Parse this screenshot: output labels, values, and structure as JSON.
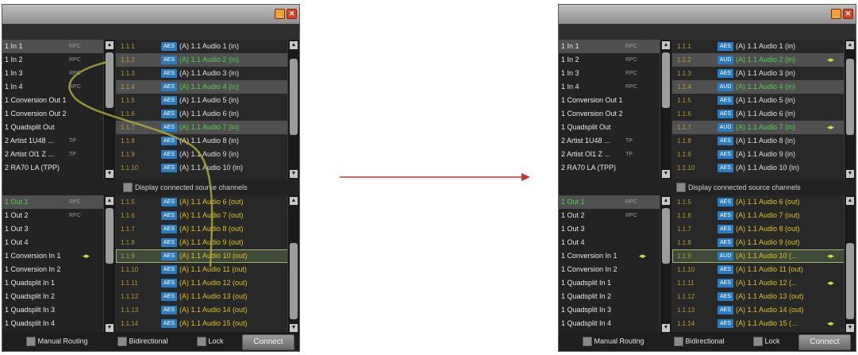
{
  "windows": [
    {
      "sources": [
        {
          "name": "1 In 1",
          "tag": "RPC",
          "conn": "",
          "hl": true
        },
        {
          "name": "1 In 2",
          "tag": "RPC",
          "conn": ""
        },
        {
          "name": "1 In 3",
          "tag": "RPC",
          "conn": ""
        },
        {
          "name": "1 In 4",
          "tag": "RPC",
          "conn": ""
        },
        {
          "name": "1 Conversion Out 1",
          "tag": "",
          "conn": ""
        },
        {
          "name": "1 Conversion Out 2",
          "tag": "",
          "conn": ""
        },
        {
          "name": "1 Quadsplit Out",
          "tag": "",
          "conn": ""
        },
        {
          "name": "2 Artist 1U48 ...",
          "tag": "TP",
          "conn": ""
        },
        {
          "name": "2 Artist Ol1 Z ...",
          "tag": "TP",
          "conn": ""
        },
        {
          "name": "2 RA70 LA (TPP)",
          "tag": "",
          "conn": ""
        }
      ],
      "source_channels": [
        {
          "num": "1.1.1",
          "tag": "AES",
          "name": "(A) 1.1 Audio 1 (in)",
          "color": "white"
        },
        {
          "num": "1.1.2",
          "tag": "AES",
          "name": "(A) 1.1 Audio 2 (in)",
          "color": "green",
          "hl": true
        },
        {
          "num": "1.1.3",
          "tag": "AES",
          "name": "(A) 1.1 Audio 3 (in)",
          "color": "white"
        },
        {
          "num": "1.1.4",
          "tag": "AES",
          "name": "(A) 1.1 Audio 4 (in)",
          "color": "green",
          "hl": true
        },
        {
          "num": "1.1.5",
          "tag": "AES",
          "name": "(A) 1.1 Audio 5 (in)",
          "color": "white"
        },
        {
          "num": "1.1.6",
          "tag": "AES",
          "name": "(A) 1.1 Audio 6 (in)",
          "color": "white"
        },
        {
          "num": "1.1.7",
          "tag": "AES",
          "name": "(A) 1.1 Audio 7 (in)",
          "color": "green",
          "hl": true
        },
        {
          "num": "1.1.8",
          "tag": "AES",
          "name": "(A) 1.1 Audio 8 (in)",
          "color": "white"
        },
        {
          "num": "1.1.9",
          "tag": "AES",
          "name": "(A) 1.1 Audio 9 (in)",
          "color": "white"
        },
        {
          "num": "1.1.10",
          "tag": "AES",
          "name": "(A) 1.1 Audio 10 (in)",
          "color": "white"
        }
      ],
      "checkbox_label": "Display connected source channels",
      "destinations": [
        {
          "name": "1 Out 1",
          "tag": "RPC",
          "conn": "",
          "hl": true,
          "color": "green"
        },
        {
          "name": "1 Out 2",
          "tag": "RPC",
          "conn": "",
          "color": "white"
        },
        {
          "name": "1 Out 3",
          "tag": "",
          "conn": "",
          "color": "white"
        },
        {
          "name": "1 Out 4",
          "tag": "",
          "conn": "",
          "color": "white"
        },
        {
          "name": "1 Conversion In 1",
          "tag": "",
          "conn": "◂▸",
          "color": "white"
        },
        {
          "name": "1 Conversion In 2",
          "tag": "",
          "conn": "",
          "color": "white"
        },
        {
          "name": "1 Quadsplit In 1",
          "tag": "",
          "conn": "",
          "color": "white"
        },
        {
          "name": "1 Quadsplit In 2",
          "tag": "",
          "conn": "",
          "color": "white"
        },
        {
          "name": "1 Quadsplit In 3",
          "tag": "",
          "conn": "",
          "color": "white"
        },
        {
          "name": "1 Quadsplit In 4",
          "tag": "",
          "conn": "",
          "color": "white"
        }
      ],
      "dest_channels": [
        {
          "num": "1.1.5",
          "tag": "AES",
          "name": "(A) 1.1 Audio 6 (out)",
          "color": "yellow"
        },
        {
          "num": "1.1.6",
          "tag": "AES",
          "name": "(A) 1.1 Audio 7 (out)",
          "color": "yellow"
        },
        {
          "num": "1.1.7",
          "tag": "AES",
          "name": "(A) 1.1 Audio 8 (out)",
          "color": "yellow"
        },
        {
          "num": "1.1.8",
          "tag": "AES",
          "name": "(A) 1.1 Audio 9 (out)",
          "color": "yellow"
        },
        {
          "num": "1.1.9",
          "tag": "AES",
          "name": "(A) 1.1 Audio 10 (out)",
          "color": "yellow",
          "sel": true
        },
        {
          "num": "1.1.10",
          "tag": "AES",
          "name": "(A) 1.1 Audio 11 (out)",
          "color": "yellow"
        },
        {
          "num": "1.1.11",
          "tag": "AES",
          "name": "(A) 1.1 Audio 12 (out)",
          "color": "yellow"
        },
        {
          "num": "1.1.12",
          "tag": "AES",
          "name": "(A) 1.1 Audio 13 (out)",
          "color": "yellow"
        },
        {
          "num": "1.1.13",
          "tag": "AES",
          "name": "(A) 1.1 Audio 14 (out)",
          "color": "yellow"
        },
        {
          "num": "1.1.14",
          "tag": "AES",
          "name": "(A) 1.1 Audio 15 (out)",
          "color": "yellow"
        }
      ],
      "bottom": {
        "manual_routing": "Manual Routing",
        "bidirectional": "Bidirectional",
        "lock": "Lock",
        "connect": "Connect"
      }
    },
    {
      "sources": [
        {
          "name": "1 In 1",
          "tag": "RPC",
          "conn": "",
          "hl": true
        },
        {
          "name": "1 In 2",
          "tag": "RPC",
          "conn": ""
        },
        {
          "name": "1 In 3",
          "tag": "RPC",
          "conn": ""
        },
        {
          "name": "1 In 4",
          "tag": "RPC",
          "conn": ""
        },
        {
          "name": "1 Conversion Out 1",
          "tag": "",
          "conn": ""
        },
        {
          "name": "1 Conversion Out 2",
          "tag": "",
          "conn": ""
        },
        {
          "name": "1 Quadsplit Out",
          "tag": "",
          "conn": ""
        },
        {
          "name": "2 Artist 1U48 ...",
          "tag": "TP",
          "conn": ""
        },
        {
          "name": "2 Artist Ol1 Z ...",
          "tag": "TP",
          "conn": ""
        },
        {
          "name": "2 RA70 LA (TPP)",
          "tag": "",
          "conn": ""
        }
      ],
      "source_channels": [
        {
          "num": "1.1.1",
          "tag": "AES",
          "name": "(A) 1.1 Audio 1 (in)",
          "color": "white"
        },
        {
          "num": "1.1.2",
          "tag": "AUD",
          "name": "(A) 1.1 Audio 2 (in)",
          "color": "green",
          "hl": true,
          "conn": "◂▸"
        },
        {
          "num": "1.1.3",
          "tag": "AES",
          "name": "(A) 1.1 Audio 3 (in)",
          "color": "white"
        },
        {
          "num": "1.1.4",
          "tag": "AUD",
          "name": "(A) 1.1 Audio 4 (in)",
          "color": "green",
          "hl": true
        },
        {
          "num": "1.1.5",
          "tag": "AES",
          "name": "(A) 1.1 Audio 5 (in)",
          "color": "white"
        },
        {
          "num": "1.1.6",
          "tag": "AES",
          "name": "(A) 1.1 Audio 6 (in)",
          "color": "white"
        },
        {
          "num": "1.1.7",
          "tag": "AUD",
          "name": "(A) 1.1 Audio 7 (in)",
          "color": "green",
          "hl": true,
          "conn": "◂▸"
        },
        {
          "num": "1.1.8",
          "tag": "AES",
          "name": "(A) 1.1 Audio 8 (in)",
          "color": "white"
        },
        {
          "num": "1.1.9",
          "tag": "AES",
          "name": "(A) 1.1 Audio 9 (in)",
          "color": "white"
        },
        {
          "num": "1.1.10",
          "tag": "AES",
          "name": "(A) 1.1 Audio 10 (in)",
          "color": "white"
        }
      ],
      "checkbox_label": "Display connected source channels",
      "destinations": [
        {
          "name": "1 Out 1",
          "tag": "RPC",
          "conn": "",
          "hl": true,
          "color": "green"
        },
        {
          "name": "1 Out 2",
          "tag": "RPC",
          "conn": "",
          "color": "white"
        },
        {
          "name": "1 Out 3",
          "tag": "",
          "conn": "",
          "color": "white"
        },
        {
          "name": "1 Out 4",
          "tag": "",
          "conn": "",
          "color": "white"
        },
        {
          "name": "1 Conversion In 1",
          "tag": "",
          "conn": "◂▸",
          "color": "white"
        },
        {
          "name": "1 Conversion In 2",
          "tag": "",
          "conn": "",
          "color": "white"
        },
        {
          "name": "1 Quadsplit In 1",
          "tag": "",
          "conn": "",
          "color": "white"
        },
        {
          "name": "1 Quadsplit In 2",
          "tag": "",
          "conn": "",
          "color": "white"
        },
        {
          "name": "1 Quadsplit In 3",
          "tag": "",
          "conn": "",
          "color": "white"
        },
        {
          "name": "1 Quadsplit In 4",
          "tag": "",
          "conn": "",
          "color": "white"
        }
      ],
      "dest_channels": [
        {
          "num": "1.1.5",
          "tag": "AES",
          "name": "(A) 1.1 Audio 6 (out)",
          "color": "yellow"
        },
        {
          "num": "1.1.6",
          "tag": "AES",
          "name": "(A) 1.1 Audio 7 (out)",
          "color": "yellow"
        },
        {
          "num": "1.1.7",
          "tag": "AES",
          "name": "(A) 1.1 Audio 8 (out)",
          "color": "yellow"
        },
        {
          "num": "1.1.8",
          "tag": "AES",
          "name": "(A) 1.1 Audio 9 (out)",
          "color": "yellow"
        },
        {
          "num": "1.1.9",
          "tag": "AUD",
          "name": "(A) 1.1 Audio 10 (...",
          "color": "yellow",
          "sel": true,
          "conn": "◂▸"
        },
        {
          "num": "1.1.10",
          "tag": "AES",
          "name": "(A) 1.1 Audio 11 (out)",
          "color": "yellow"
        },
        {
          "num": "1.1.11",
          "tag": "AES",
          "name": "(A) 1.1 Audio 12 (...",
          "color": "yellow",
          "conn": "◂▸"
        },
        {
          "num": "1.1.12",
          "tag": "AES",
          "name": "(A) 1.1 Audio 13 (out)",
          "color": "yellow"
        },
        {
          "num": "1.1.13",
          "tag": "AES",
          "name": "(A) 1.1 Audio 14 (out)",
          "color": "yellow"
        },
        {
          "num": "1.1.14",
          "tag": "AES",
          "name": "(A) 1.1 Audio 15 (...",
          "color": "yellow",
          "conn": "◂▸"
        }
      ],
      "bottom": {
        "manual_routing": "Manual Routing",
        "bidirectional": "Bidirectional",
        "lock": "Lock",
        "connect": "Connect"
      }
    }
  ],
  "icons": {
    "minimize": "minimize-icon",
    "close": "close-icon",
    "connection": "connection-arrows-icon",
    "arrow": "right-arrow-icon"
  },
  "colors": {
    "arrow": "#d03030",
    "connected_src": "#4cd04c",
    "dest_channel": "#e0c020",
    "tag_bg": "#2a7bc0",
    "drag_line": "#a8a838"
  }
}
